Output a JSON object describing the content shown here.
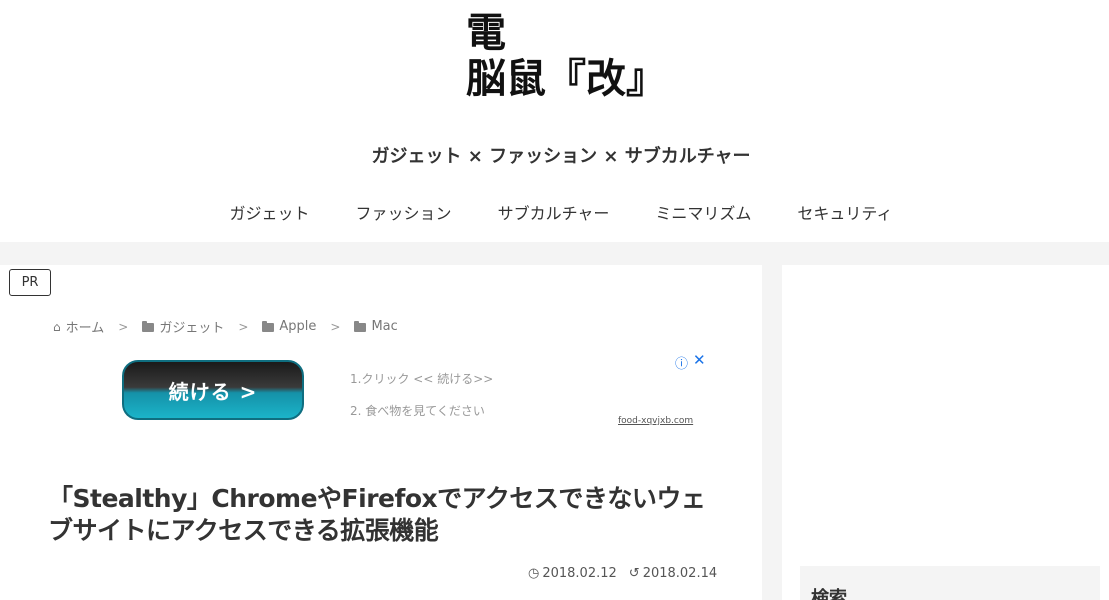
{
  "site": {
    "logo_line1": "電",
    "logo_line2": "脳鼠『改』",
    "tagline": "ガジェット × ファッション × サブカルチャー"
  },
  "nav": {
    "items": [
      "ガジェット",
      "ファッション",
      "サブカルチャー",
      "ミニマリズム",
      "セキュリティ"
    ]
  },
  "badge": {
    "label": "PR"
  },
  "breadcrumb": {
    "home": "ホーム",
    "items": [
      "ガジェット",
      "Apple",
      "Mac"
    ]
  },
  "ad": {
    "button_label": "続ける >",
    "line1": "1.クリック << 続ける>>",
    "line2": "2. 食べ物を見てください",
    "domain": "food-xqvjxb.com",
    "info_icon": "ⓘ",
    "close_icon": "✕"
  },
  "article": {
    "title": "「Stealthy」ChromeやFirefoxでアクセスできないウェブサイトにアクセスできる拡張機能",
    "published": "2018.02.12",
    "updated": "2018.02.14"
  },
  "sidebar": {
    "widget_title": "検索"
  }
}
